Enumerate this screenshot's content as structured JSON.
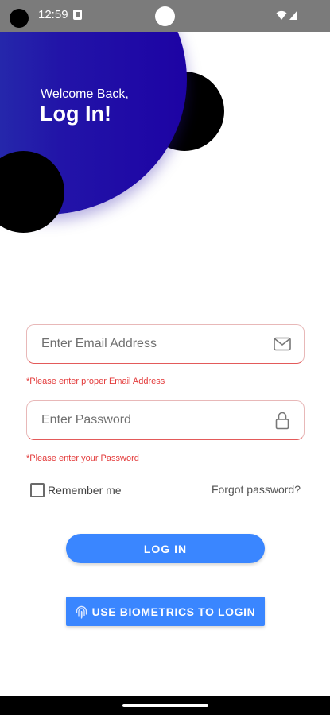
{
  "status_bar": {
    "time": "12:59",
    "icons": [
      "app-notification-icon",
      "wifi-icon",
      "signal-icon"
    ]
  },
  "header": {
    "welcome": "Welcome Back,",
    "title": "Log In!"
  },
  "form": {
    "email": {
      "placeholder": "Enter Email Address",
      "value": "",
      "icon": "mail-icon",
      "error": "*Please enter proper Email Address"
    },
    "password": {
      "placeholder": "Enter Password",
      "value": "",
      "icon": "lock-icon",
      "error": "*Please enter your Password"
    },
    "remember_label": "Remember me",
    "remember_checked": false,
    "forgot_label": "Forgot password?"
  },
  "buttons": {
    "login_label": "LOG IN",
    "biometrics_label": "USE BIOMETRICS TO LOGIN",
    "biometrics_icon": "fingerprint-icon"
  },
  "colors": {
    "primary_button": "#3a86ff",
    "header_gradient_start": "#2a46b0",
    "header_gradient_end": "#1d03a4",
    "error": "#e33a3a",
    "status_bar": "#7b7b7b"
  }
}
